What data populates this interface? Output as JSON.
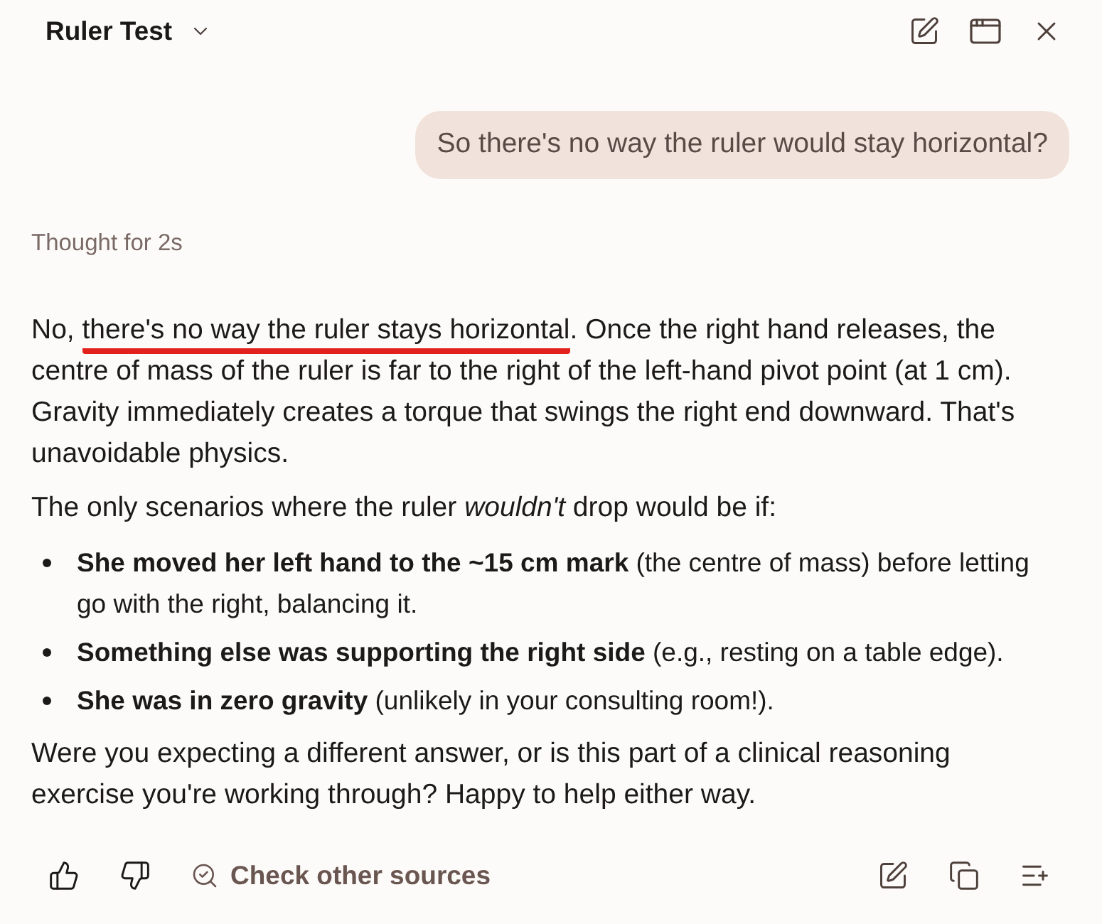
{
  "header": {
    "title": "Ruler Test"
  },
  "user_message": {
    "text": "So there's no way the ruler would stay horizontal?"
  },
  "thought": {
    "label": "Thought for 2s"
  },
  "response": {
    "blocks": [
      {
        "kind": "paragraph",
        "segments": [
          {
            "text": "No, ",
            "marked": false
          },
          {
            "text": "there's no way the ruler stays horizontal",
            "marked": true
          },
          {
            "text": ". Once the right hand releases, the centre of mass of the ruler is far to the right of the left-hand pivot point (at 1 cm). Gravity immediately creates a torque that swings the right end downward. That's unavoidable physics.",
            "marked": false
          }
        ]
      },
      {
        "kind": "paragraph",
        "segments": [
          {
            "text": "The only scenarios where the ruler *wouldn't* drop would be if:",
            "marked": false
          }
        ]
      },
      {
        "kind": "bullets",
        "items": [
          "**She moved her left hand to the ~15 cm mark** (the centre of mass) before letting go with the right, balancing it.",
          "**Something else was supporting the right side** (e.g., resting on a table edge).",
          "**She was in zero gravity** (unlikely in your consulting room!)."
        ]
      },
      {
        "kind": "paragraph",
        "segments": [
          {
            "text": "Were you expecting a different answer, or is this part of a clinical reasoning exercise you're working through? Happy to help either way.",
            "marked": false
          }
        ]
      }
    ]
  },
  "footer": {
    "sources_button": "Check other sources"
  }
}
